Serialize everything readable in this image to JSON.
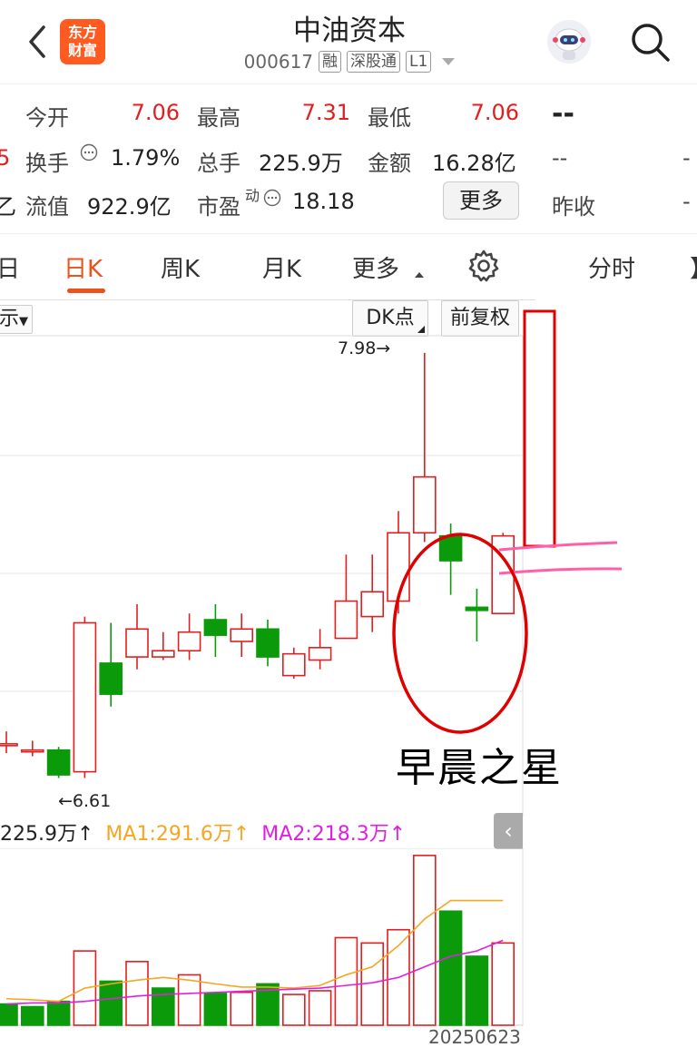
{
  "header": {
    "title": "中油资本",
    "code": "000617",
    "tags": [
      "融",
      "深股通",
      "L1"
    ],
    "logo_line1": "东方",
    "logo_line2": "财富"
  },
  "stats": {
    "row1": [
      {
        "label": "今开",
        "value": "7.06"
      },
      {
        "label": "最高",
        "value": "7.31"
      },
      {
        "label": "最低",
        "value": "7.06"
      },
      {
        "label": "",
        "value": "--"
      }
    ],
    "row2": [
      {
        "label": "换手",
        "value": "1.79%"
      },
      {
        "label": "总手",
        "value": "225.9万"
      },
      {
        "label": "金额",
        "value": "16.28亿"
      },
      {
        "label": "",
        "value": "--"
      }
    ],
    "row3": [
      {
        "label": "流值",
        "value": "922.9亿"
      },
      {
        "label": "市盈",
        "sup": "动",
        "value": "18.18"
      },
      {
        "label": "昨收",
        "value": "--"
      }
    ],
    "left_edge_row2": "5",
    "left_edge_row3": "乙",
    "right_edge_row2": "-",
    "right_edge_row3": "-",
    "more_button": "更多"
  },
  "tabs": [
    {
      "label": "日",
      "partial": true
    },
    {
      "label": "日K",
      "active": true
    },
    {
      "label": "周K"
    },
    {
      "label": "月K"
    },
    {
      "label": "更多"
    },
    {
      "label": "settings",
      "icon": "gear-icon"
    },
    {
      "label": "分时"
    },
    {
      "label": "】",
      "partial": true
    }
  ],
  "chart_toolbar": {
    "indicator_select": "示",
    "dk_button": "DK点",
    "adjust_button": "前复权"
  },
  "chart_labels": {
    "high_label": "7.98→",
    "low_label": "←6.61"
  },
  "annotation_text": "早晨之星",
  "volume_legend": {
    "vol": "225.9万↑",
    "ma1": "MA1:291.6万↑",
    "ma2": "MA2:218.3万↑"
  },
  "date_label": "20250623",
  "colors": {
    "up": "#e02020",
    "down": "#0a9a0a",
    "accent": "#e8541c",
    "ma1": "#f5a623",
    "ma2": "#e020e0"
  },
  "chart_data": {
    "type": "candlestick",
    "candles": [
      {
        "open": 6.72,
        "close": 6.72,
        "high": 6.76,
        "low": 6.69
      },
      {
        "open": 6.7,
        "close": 6.7,
        "high": 6.73,
        "low": 6.68
      },
      {
        "open": 6.7,
        "close": 6.62,
        "high": 6.71,
        "low": 6.61
      },
      {
        "open": 6.63,
        "close": 7.11,
        "high": 7.13,
        "low": 6.61
      },
      {
        "open": 6.98,
        "close": 6.88,
        "high": 7.11,
        "low": 6.84
      },
      {
        "open": 7.0,
        "close": 7.09,
        "high": 7.17,
        "low": 6.96
      },
      {
        "open": 7.0,
        "close": 7.02,
        "high": 7.08,
        "low": 6.99
      },
      {
        "open": 7.02,
        "close": 7.08,
        "high": 7.14,
        "low": 6.99
      },
      {
        "open": 7.12,
        "close": 7.07,
        "high": 7.17,
        "low": 7.0
      },
      {
        "open": 7.05,
        "close": 7.09,
        "high": 7.14,
        "low": 7.0
      },
      {
        "open": 7.09,
        "close": 7.0,
        "high": 7.12,
        "low": 6.97
      },
      {
        "open": 6.94,
        "close": 7.01,
        "high": 7.03,
        "low": 6.93
      },
      {
        "open": 6.99,
        "close": 7.03,
        "high": 7.09,
        "low": 6.96
      },
      {
        "open": 7.06,
        "close": 7.18,
        "high": 7.33,
        "low": 7.06
      },
      {
        "open": 7.13,
        "close": 7.21,
        "high": 7.33,
        "low": 7.08
      },
      {
        "open": 7.18,
        "close": 7.4,
        "high": 7.47,
        "low": 7.14
      },
      {
        "open": 7.4,
        "close": 7.58,
        "high": 7.98,
        "low": 7.37
      },
      {
        "open": 7.39,
        "close": 7.31,
        "high": 7.43,
        "low": 7.2
      },
      {
        "open": 7.16,
        "close": 7.15,
        "high": 7.22,
        "low": 7.05
      },
      {
        "open": 7.14,
        "close": 7.39,
        "high": 7.4,
        "low": 7.14
      }
    ],
    "volume": {
      "values": [
        40,
        35,
        45,
        140,
        83,
        120,
        70,
        95,
        60,
        62,
        78,
        58,
        65,
        165,
        155,
        180,
        320,
        215,
        130,
        155
      ],
      "up": [
        false,
        false,
        false,
        true,
        false,
        true,
        false,
        true,
        false,
        true,
        false,
        true,
        true,
        true,
        true,
        true,
        true,
        false,
        false,
        true
      ],
      "ma1": [
        50,
        48,
        45,
        70,
        78,
        85,
        90,
        85,
        78,
        72,
        72,
        70,
        75,
        95,
        110,
        150,
        200,
        235,
        235,
        235
      ],
      "ma2": [
        40,
        42,
        42,
        45,
        50,
        55,
        58,
        60,
        62,
        64,
        66,
        68,
        70,
        75,
        80,
        90,
        110,
        130,
        140,
        160
      ]
    }
  }
}
